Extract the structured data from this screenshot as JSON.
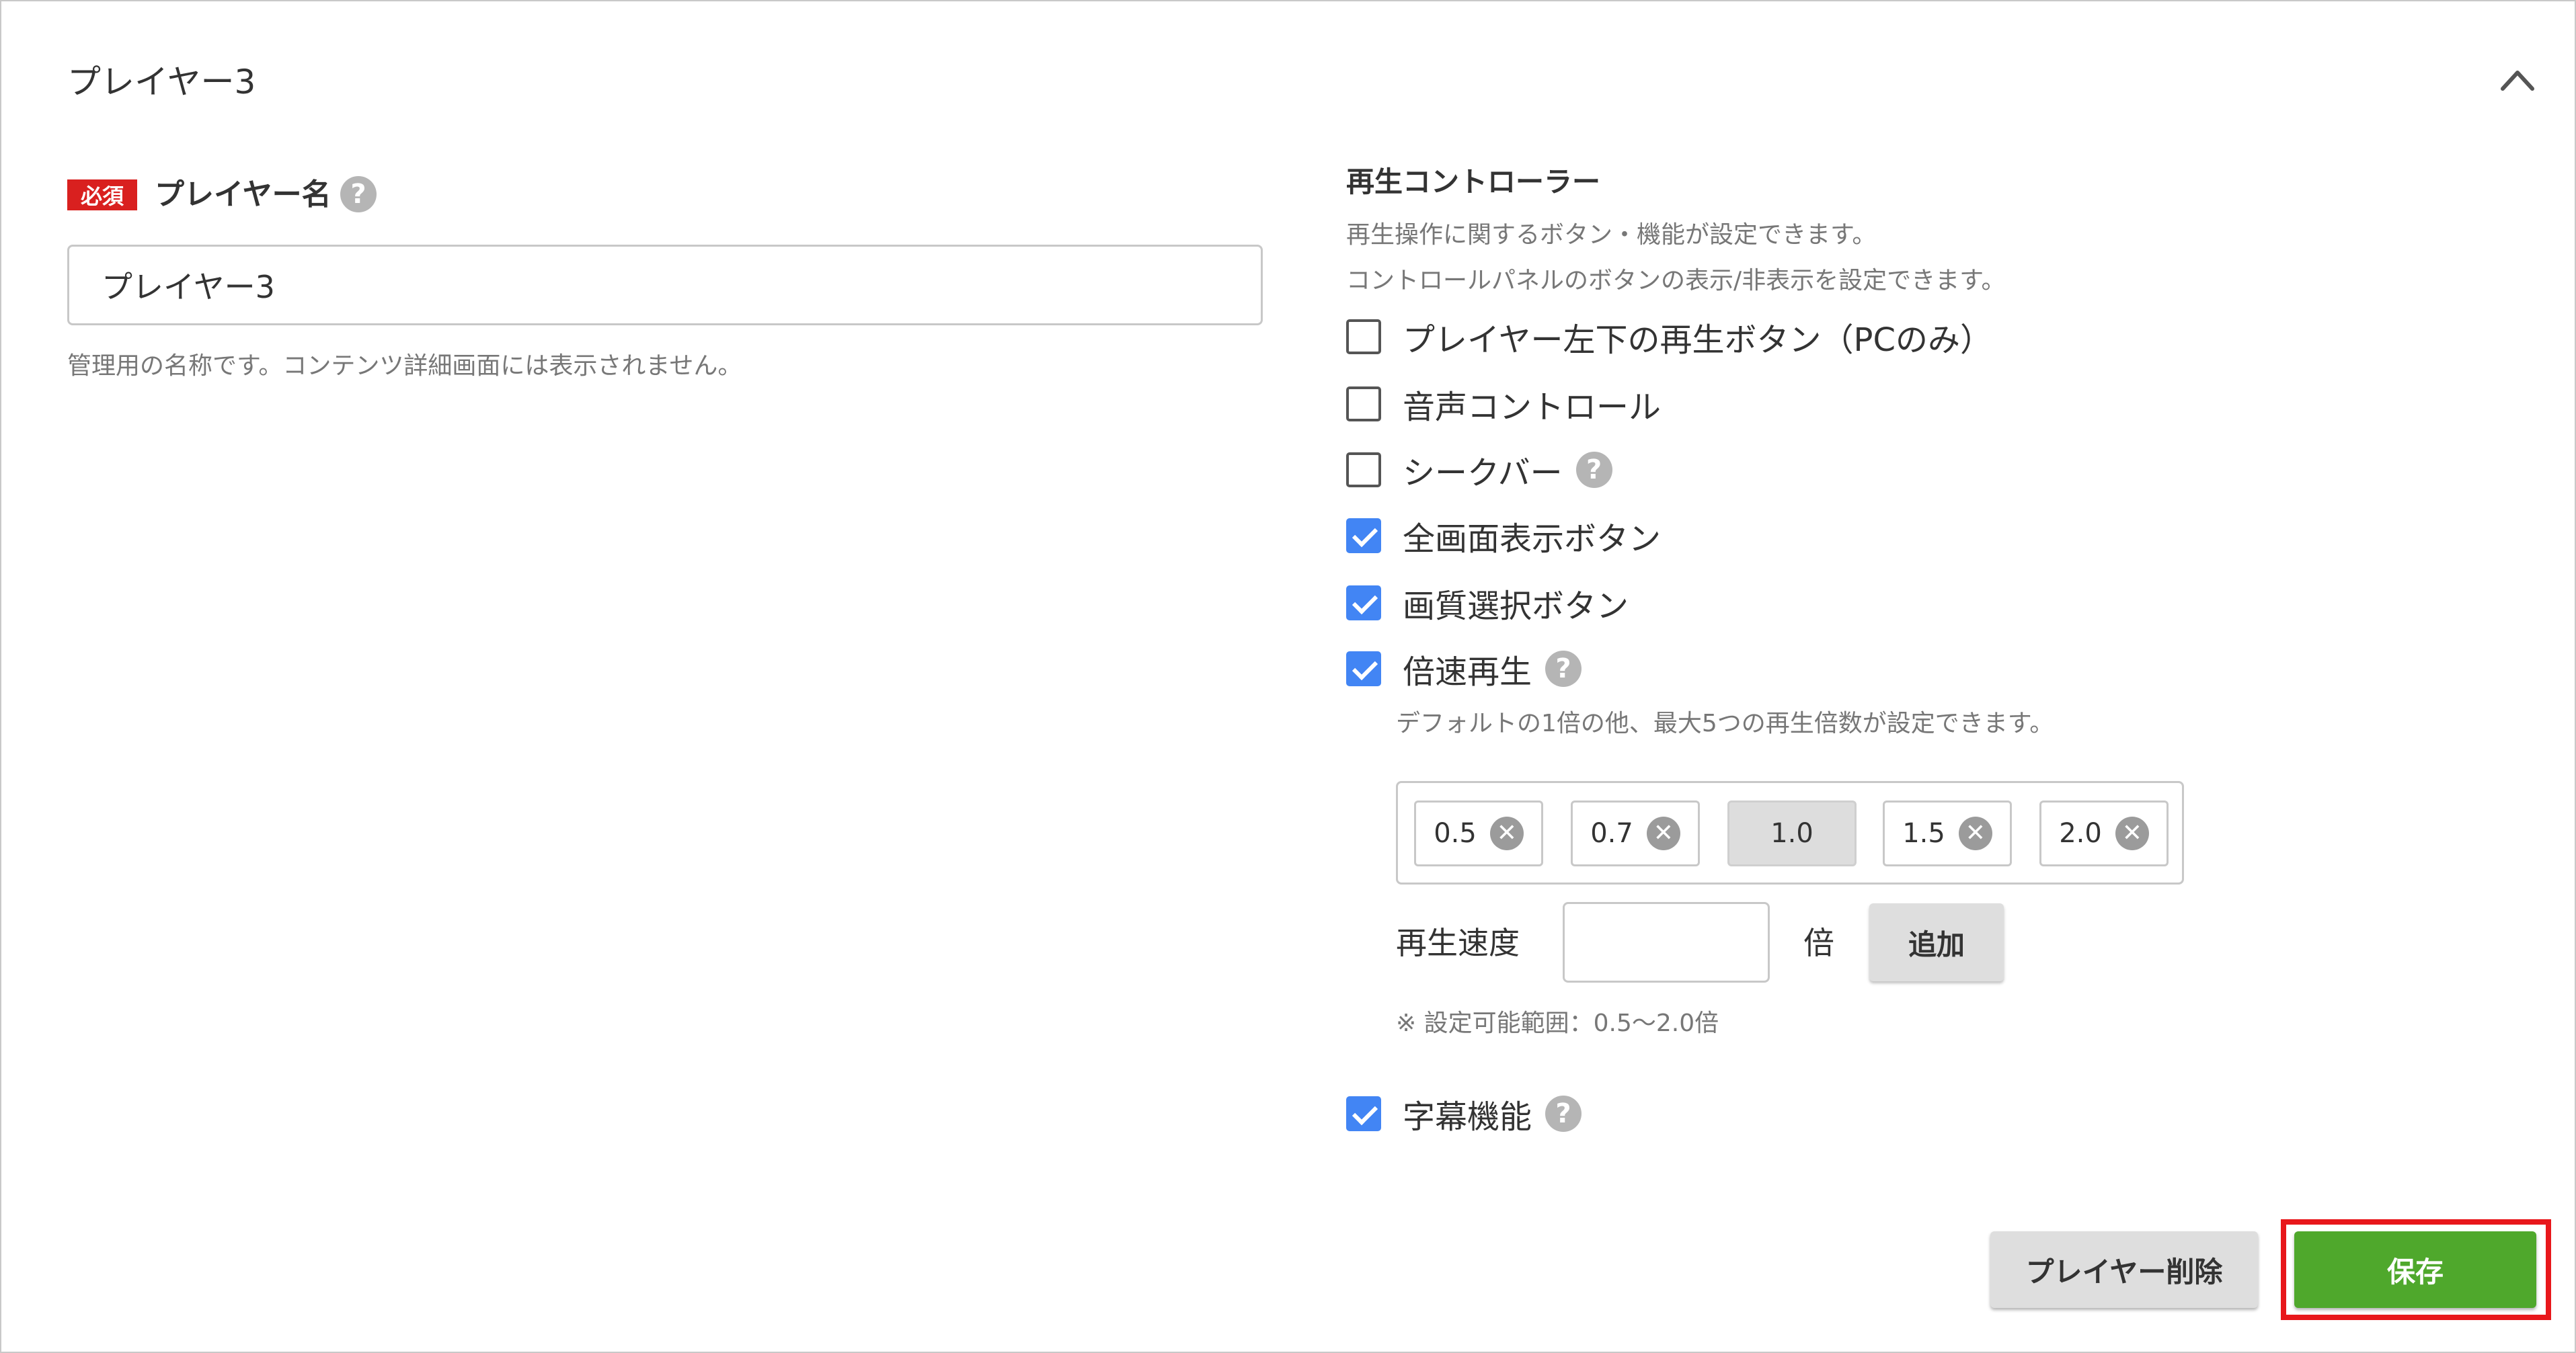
{
  "panel": {
    "title": "プレイヤー3",
    "collapse_icon": "chevron-up-icon"
  },
  "player_name": {
    "required_badge": "必須",
    "label": "プレイヤー名",
    "help_glyph": "?",
    "value": "プレイヤー3",
    "hint": "管理用の名称です。コンテンツ詳細画面には表示されません。"
  },
  "controller": {
    "title": "再生コントローラー",
    "desc1": "再生操作に関するボタン・機能が設定できます。",
    "desc2": "コントロールパネルのボタンの表示/非表示を設定できます。",
    "options": [
      {
        "label": "プレイヤー左下の再生ボタン（PCのみ）",
        "checked": false
      },
      {
        "label": "音声コントロール",
        "checked": false
      },
      {
        "label": "シークバー",
        "checked": false,
        "help": true
      },
      {
        "label": "全画面表示ボタン",
        "checked": true
      },
      {
        "label": "画質選択ボタン",
        "checked": true
      },
      {
        "label": "倍速再生",
        "checked": true,
        "help": true
      }
    ],
    "subtitles": {
      "label": "字幕機能",
      "checked": true,
      "help": true
    }
  },
  "speed": {
    "desc": "デフォルトの1倍の他、最大5つの再生倍数が設定できます。",
    "chips": [
      {
        "value": "0.5",
        "removable": true
      },
      {
        "value": "0.7",
        "removable": true
      },
      {
        "value": "1.0",
        "removable": false
      },
      {
        "value": "1.5",
        "removable": true
      },
      {
        "value": "2.0",
        "removable": true
      }
    ],
    "remove_glyph": "✕",
    "input_label": "再生速度",
    "input_value": "",
    "unit": "倍",
    "add_label": "追加",
    "range_note": "※ 設定可能範囲：0.5〜2.0倍"
  },
  "footer": {
    "delete_label": "プレイヤー削除",
    "save_label": "保存"
  },
  "colors": {
    "required_badge": "#d9201f",
    "checkbox_checked": "#4285f4",
    "save_button": "#4fa82c",
    "highlight_frame": "#e8171b"
  }
}
